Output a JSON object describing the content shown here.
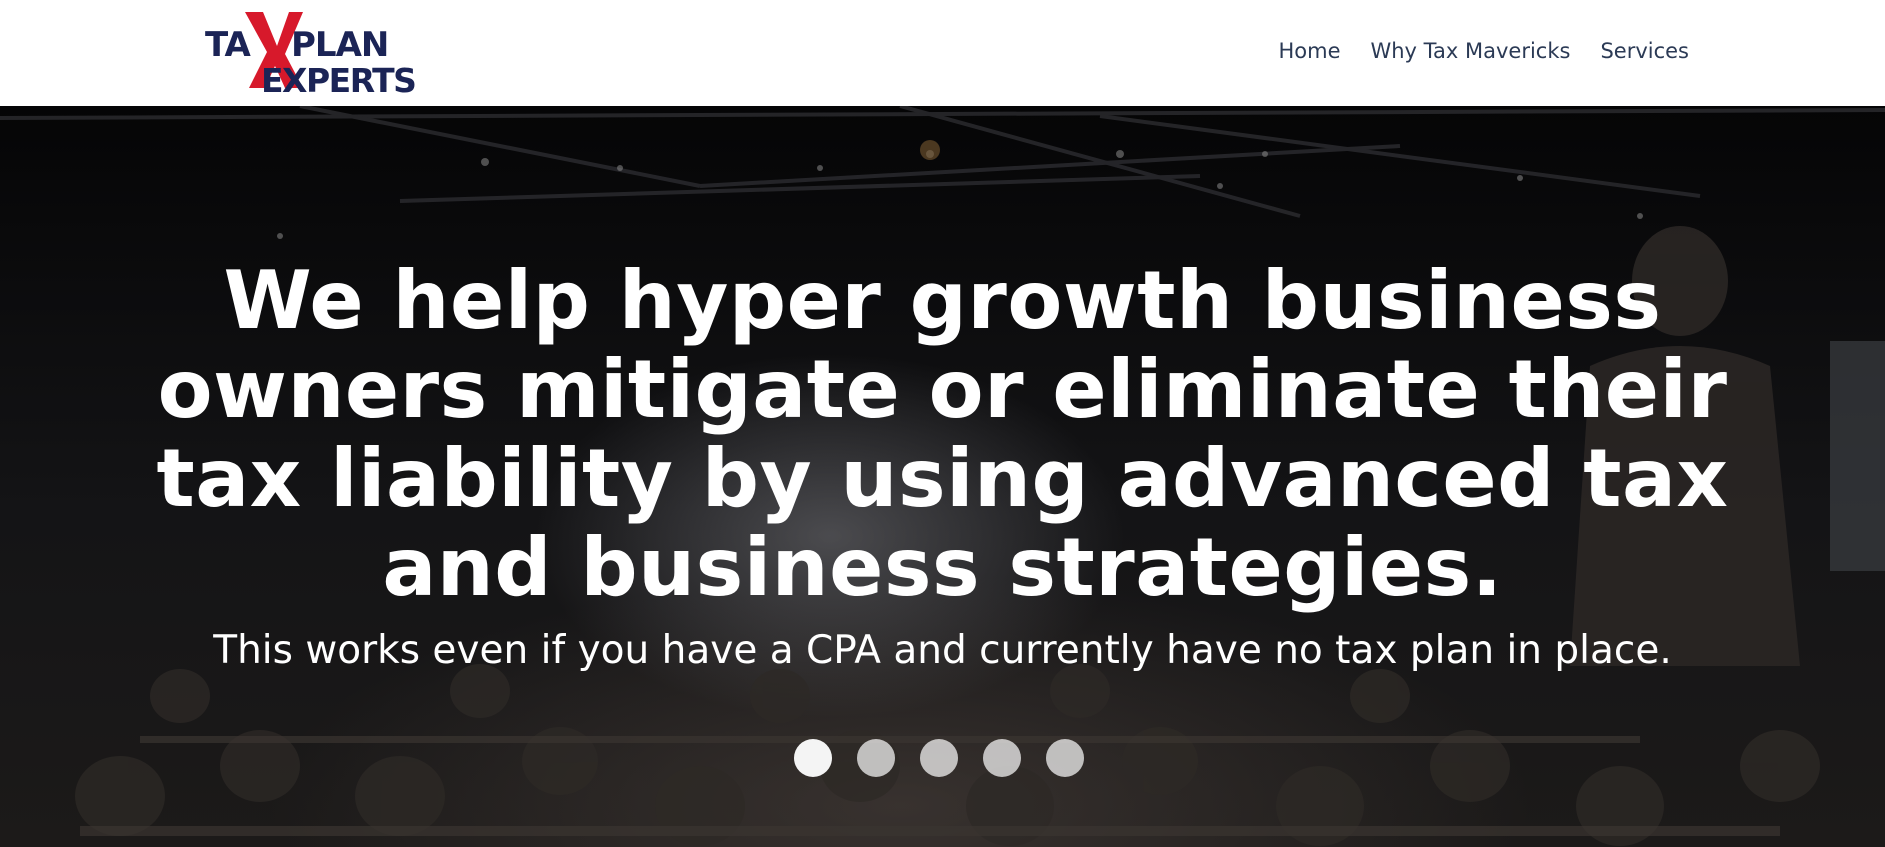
{
  "brand": {
    "logo_line1": "TAXPLAN",
    "logo_line2": "EXPERTS",
    "logo_x_color": "#d7192b",
    "logo_text_color": "#1b2456"
  },
  "nav": {
    "items": [
      {
        "label": "Home"
      },
      {
        "label": "Why Tax Mavericks"
      },
      {
        "label": "Services"
      }
    ]
  },
  "hero": {
    "headline": "We help hyper growth business owners mitigate or eliminate their tax liability by using advanced tax and business strategies.",
    "subheadline": "This works even if you have a CPA and currently have no tax plan in place.",
    "background": "dark conference hall audience with speaker at podium",
    "slider": {
      "total_slides": 5,
      "active_index": 0
    }
  }
}
